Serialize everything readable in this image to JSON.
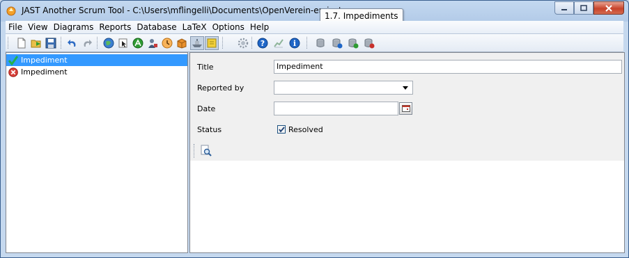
{
  "window": {
    "title": "JAST Another Scrum Tool  -  C:\\Users\\mflingelli\\Documents\\OpenVerein-en.jast",
    "tooltip": "1.7. Impediments",
    "caption_icons": [
      "minimize-icon",
      "maximize-icon",
      "close-icon"
    ]
  },
  "menu": {
    "items": [
      "File",
      "View",
      "Diagrams",
      "Reports",
      "Database",
      "LaTeX",
      "Options",
      "Help"
    ]
  },
  "toolbar": {
    "icons": [
      "new-document-icon",
      "open-folder-icon",
      "save-icon",
      "undo-icon",
      "redo-icon",
      "globe-icon",
      "cursor-icon",
      "run-icon",
      "user-icon",
      "clock-icon",
      "box-icon",
      "ship-icon",
      "note-icon",
      "settings-icon",
      "help-icon",
      "chart-icon",
      "info-icon",
      "database-icon",
      "database-add-icon",
      "database-go-icon",
      "database-delete-icon"
    ]
  },
  "tree": {
    "items": [
      {
        "label": "Impediment",
        "icon": "check-icon",
        "selected": true
      },
      {
        "label": "Impediment",
        "icon": "error-icon",
        "selected": false
      }
    ]
  },
  "form": {
    "title_label": "Title",
    "title_value": "Impediment",
    "reported_label": "Reported by",
    "reported_value": "",
    "date_label": "Date",
    "date_value": "",
    "status_label": "Status",
    "resolved_label": "Resolved",
    "resolved_checked": true
  },
  "colors": {
    "selection": "#3399ff",
    "form_background": "#f0f0f0"
  }
}
